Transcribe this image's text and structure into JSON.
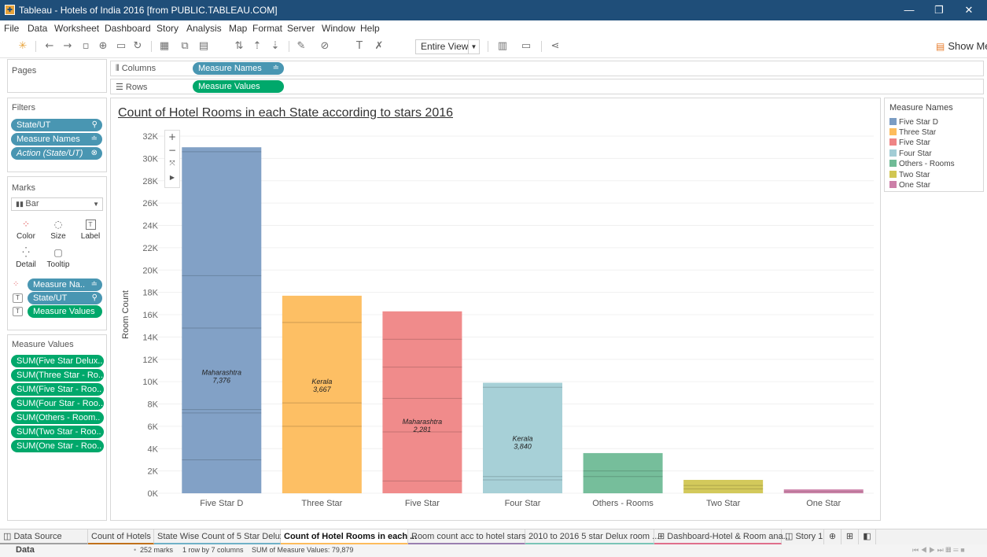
{
  "window": {
    "title": "Tableau - Hotels of India 2016 [from PUBLIC.TABLEAU.COM]"
  },
  "menu": [
    "File",
    "Data",
    "Worksheet",
    "Dashboard",
    "Story",
    "Analysis",
    "Map",
    "Format",
    "Server",
    "Window",
    "Help"
  ],
  "toolbar": {
    "fit_value": "Entire View",
    "show_me_label": "Show Me"
  },
  "pages_card": {
    "title": "Pages"
  },
  "shelves": {
    "columns_label": "Columns",
    "columns_pill": "Measure Names",
    "rows_label": "Rows",
    "rows_pill": "Measure Values"
  },
  "filters": {
    "title": "Filters",
    "pills": [
      "State/UT",
      "Measure Names",
      "Action (State/UT)"
    ]
  },
  "marks": {
    "title": "Marks",
    "type": "Bar",
    "buttons": [
      "Color",
      "Size",
      "Label",
      "Detail",
      "Tooltip"
    ],
    "fields": [
      "Measure Na..",
      "State/UT",
      "Measure Values"
    ]
  },
  "measure_values": {
    "title": "Measure Values",
    "items": [
      "SUM(Five Star Delux..",
      "SUM(Three Star - Ro..",
      "SUM(Five Star - Roo..",
      "SUM(Four Star - Roo..",
      "SUM(Others - Room..",
      "SUM(Two Star - Roo..",
      "SUM(One Star - Roo.."
    ]
  },
  "chart_data": {
    "type": "bar",
    "title": "Count of Hotel Rooms in each State according to stars 2016",
    "ylabel": "Room Count",
    "xlabel": "",
    "ylim": [
      0,
      32000
    ],
    "yticks": [
      0,
      2000,
      4000,
      6000,
      8000,
      10000,
      12000,
      14000,
      16000,
      18000,
      20000,
      22000,
      24000,
      26000,
      28000,
      30000,
      32000
    ],
    "ytick_labels": [
      "0K",
      "2K",
      "4K",
      "6K",
      "8K",
      "10K",
      "12K",
      "14K",
      "16K",
      "18K",
      "20K",
      "22K",
      "24K",
      "26K",
      "28K",
      "30K",
      "32K"
    ],
    "categories": [
      "Five Star D",
      "Three Star",
      "Five Star",
      "Four Star",
      "Others - Rooms",
      "Two Star",
      "One Star"
    ],
    "values": [
      31000,
      17700,
      16300,
      9900,
      3600,
      1200,
      350
    ],
    "colors": [
      "#7b9cc3",
      "#fdbc5c",
      "#ef8585",
      "#a2cdd5",
      "#6fbb96",
      "#d1c652",
      "#cc7fa8"
    ],
    "segments": [
      [
        0,
        3000,
        7200,
        7500,
        14800,
        19500,
        30600
      ],
      [
        0,
        6000,
        8100,
        15300
      ],
      [
        0,
        1100,
        5500,
        8500,
        11300,
        13800
      ],
      [
        0,
        1200,
        1500,
        9500
      ],
      [
        0,
        1500,
        2000
      ],
      [
        0,
        400,
        700
      ],
      [
        0,
        150
      ]
    ],
    "annotations": [
      {
        "category": "Five Star D",
        "state": "Maharashtra",
        "value": "7,376",
        "y": 10600
      },
      {
        "category": "Three Star",
        "state": "Kerala",
        "value": "3,667",
        "y": 9800
      },
      {
        "category": "Five Star",
        "state": "Maharashtra",
        "value": "2,281",
        "y": 6200
      },
      {
        "category": "Four Star",
        "state": "Kerala",
        "value": "3,840",
        "y": 4700
      }
    ],
    "gridlines": true
  },
  "legend": {
    "title": "Measure Names",
    "items": [
      {
        "label": "Five Star D",
        "color": "#7b9cc3"
      },
      {
        "label": "Three Star",
        "color": "#fdbc5c"
      },
      {
        "label": "Five Star",
        "color": "#ef8585"
      },
      {
        "label": "Four Star",
        "color": "#a2cdd5"
      },
      {
        "label": "Others - Rooms",
        "color": "#6fbb96"
      },
      {
        "label": "Two Star",
        "color": "#d1c652"
      },
      {
        "label": "One Star",
        "color": "#cc7fa8"
      }
    ]
  },
  "tabs": {
    "data_source": "Data Source",
    "sheets": [
      "Count of Hotels",
      "State Wise Count of 5 Star Delux...",
      "Count of Hotel Rooms in each ...",
      "Room count acc to hotel stars",
      "2010 to 2016 5 star Delux room ...",
      "Dashboard-Hotel & Room ana...",
      "Story 1"
    ],
    "active_index": 2
  },
  "status": {
    "section": "Data",
    "marks": "252 marks",
    "rows_cols": "1 row by 7 columns",
    "sum": "SUM of Measure Values: 79,879"
  }
}
